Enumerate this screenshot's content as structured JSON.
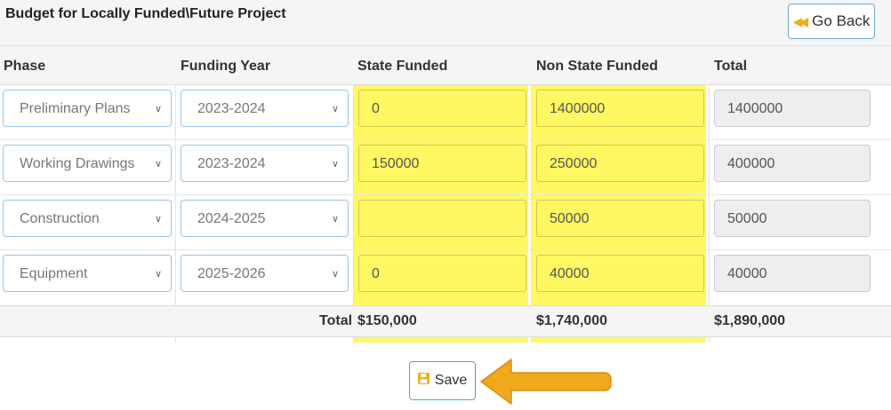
{
  "panel": {
    "title": "Budget for Locally Funded\\Future Project",
    "go_back_label": "Go Back",
    "go_back_icon": "fast-backward-icon"
  },
  "table": {
    "headers": [
      "Phase",
      "Funding Year",
      "State Funded",
      "Non State Funded",
      "Total"
    ],
    "rows": [
      {
        "phase": "Preliminary Plans",
        "funding_year": "2023-2024",
        "state_funded": "0",
        "non_state_funded": "1400000",
        "total": "1400000"
      },
      {
        "phase": "Working Drawings",
        "funding_year": "2023-2024",
        "state_funded": "150000",
        "non_state_funded": "250000",
        "total": "400000"
      },
      {
        "phase": "Construction",
        "funding_year": "2024-2025",
        "state_funded": "",
        "non_state_funded": "50000",
        "total": "50000"
      },
      {
        "phase": "Equipment",
        "funding_year": "2025-2026",
        "state_funded": "0",
        "non_state_funded": "40000",
        "total": "40000"
      }
    ],
    "totals": {
      "label": "Total",
      "state_funded": "$150,000",
      "non_state_funded": "$1,740,000",
      "total": "$1,890,000"
    }
  },
  "actions": {
    "save_label": "Save",
    "save_icon": "floppy-disk-icon"
  },
  "colors": {
    "highlight": "#fff863",
    "accent_icon": "#f0ad1e",
    "arrow": "#f0a81c",
    "input_border": "#9bc4e8"
  }
}
